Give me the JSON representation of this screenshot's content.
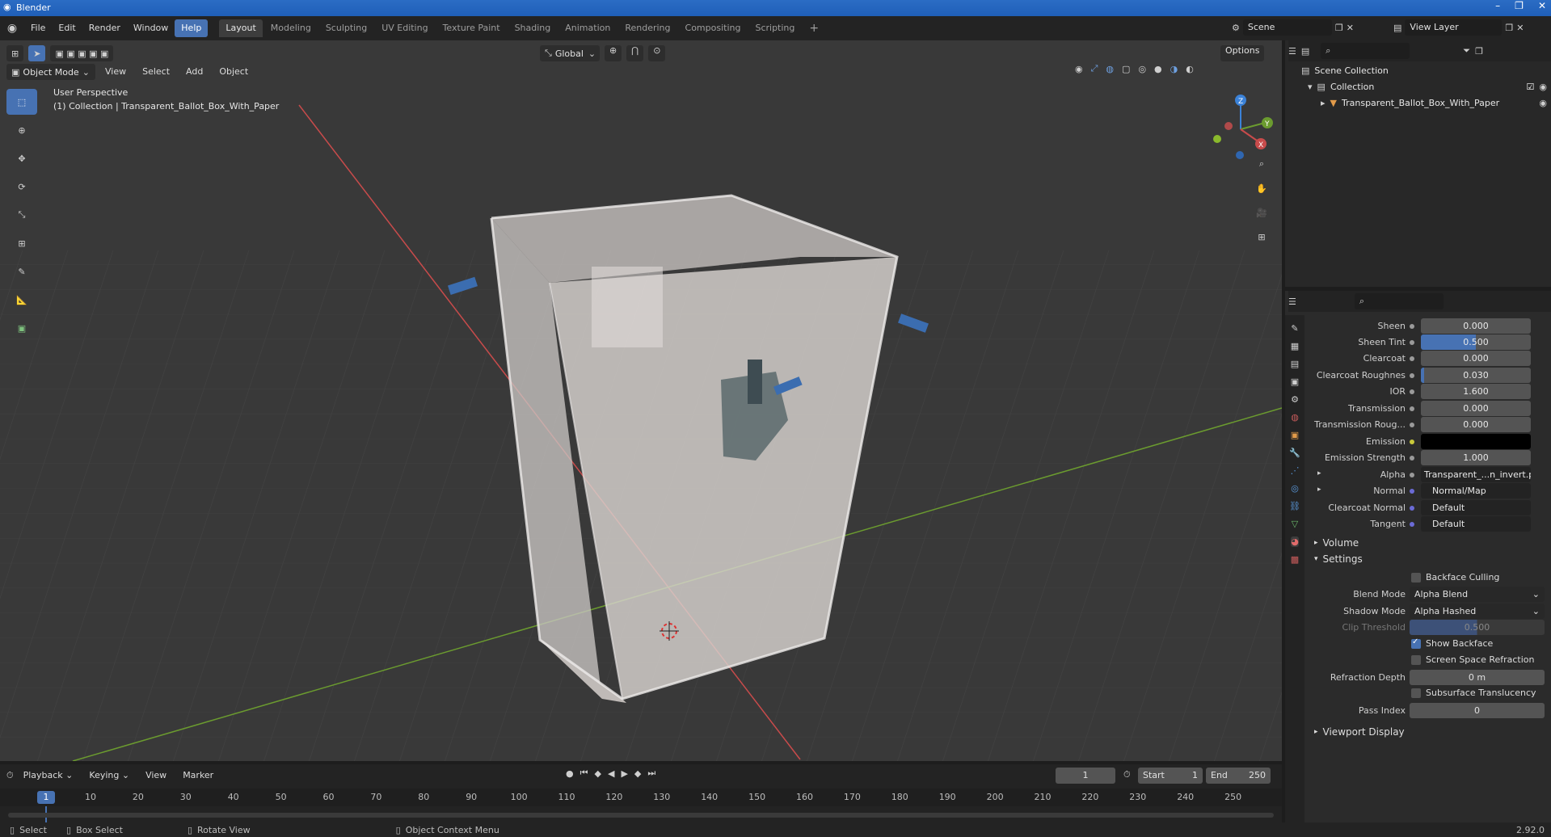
{
  "window": {
    "title": "Blender",
    "controls": [
      "–",
      "❐",
      "✕"
    ]
  },
  "menu": [
    "File",
    "Edit",
    "Render",
    "Window",
    "Help"
  ],
  "workspaces": [
    "Layout",
    "Modeling",
    "Sculpting",
    "UV Editing",
    "Texture Paint",
    "Shading",
    "Animation",
    "Rendering",
    "Compositing",
    "Scripting"
  ],
  "active_workspace": "Layout",
  "scene": {
    "name": "Scene",
    "view_layer": "View Layer"
  },
  "viewport": {
    "mode": "Object Mode",
    "menus": [
      "View",
      "Select",
      "Add",
      "Object"
    ],
    "transform_orientation": "Global",
    "options_label": "Options",
    "overlay_title": "User Perspective",
    "overlay_subtitle": "(1) Collection | Transparent_Ballot_Box_With_Paper"
  },
  "outliner": {
    "scene_collection": "Scene Collection",
    "collection": "Collection",
    "object": "Transparent_Ballot_Box_With_Paper"
  },
  "properties": {
    "rows": [
      {
        "label": "Sheen",
        "value": "0.000"
      },
      {
        "label": "Sheen Tint",
        "value": "0.500"
      },
      {
        "label": "Clearcoat",
        "value": "0.000"
      },
      {
        "label": "Clearcoat Roughnes",
        "value": "0.030"
      },
      {
        "label": "IOR",
        "value": "1.600"
      },
      {
        "label": "Transmission",
        "value": "0.000"
      },
      {
        "label": "Transmission Roug...",
        "value": "0.000"
      },
      {
        "label": "Emission",
        "value": ""
      },
      {
        "label": "Emission Strength",
        "value": "1.000"
      },
      {
        "label": "Alpha",
        "value": "Transparent_...n_invert.png"
      },
      {
        "label": "Normal",
        "value": "Normal/Map"
      },
      {
        "label": "Clearcoat Normal",
        "value": "Default"
      },
      {
        "label": "Tangent",
        "value": "Default"
      }
    ],
    "sheen_tint_fraction": 0.5,
    "clearcoat_roughness_fraction": 0.03,
    "panel_volume": "Volume",
    "panel_settings": "Settings",
    "backface_culling": "Backface Culling",
    "blend_mode_label": "Blend Mode",
    "blend_mode": "Alpha Blend",
    "shadow_mode_label": "Shadow Mode",
    "shadow_mode": "Alpha Hashed",
    "clip_threshold_label": "Clip Threshold",
    "clip_threshold": "0.500",
    "show_backface": "Show Backface",
    "screen_space_refraction": "Screen Space Refraction",
    "refraction_depth_label": "Refraction Depth",
    "refraction_depth": "0 m",
    "subsurface_translucency": "Subsurface Translucency",
    "pass_index_label": "Pass Index",
    "pass_index": "0",
    "panel_viewport_display": "Viewport Display"
  },
  "timeline": {
    "menus": [
      "Playback",
      "Keying",
      "View",
      "Marker"
    ],
    "current_frame": "1",
    "start_label": "Start",
    "start": "1",
    "end_label": "End",
    "end": "250",
    "ticks": [
      "10",
      "20",
      "30",
      "40",
      "50",
      "60",
      "70",
      "80",
      "90",
      "100",
      "110",
      "120",
      "130",
      "140",
      "150",
      "160",
      "170",
      "180",
      "190",
      "200",
      "210",
      "220",
      "230",
      "240",
      "250"
    ],
    "playhead": "1"
  },
  "status": {
    "select": "Select",
    "box_select": "Box Select",
    "rotate": "Rotate View",
    "context": "Object Context Menu",
    "version": "2.92.0"
  },
  "colors": {
    "accent": "#4772b3",
    "x_axis": "#c84b4b",
    "y_axis": "#6b9b2f",
    "z_axis": "#3b82d8"
  }
}
